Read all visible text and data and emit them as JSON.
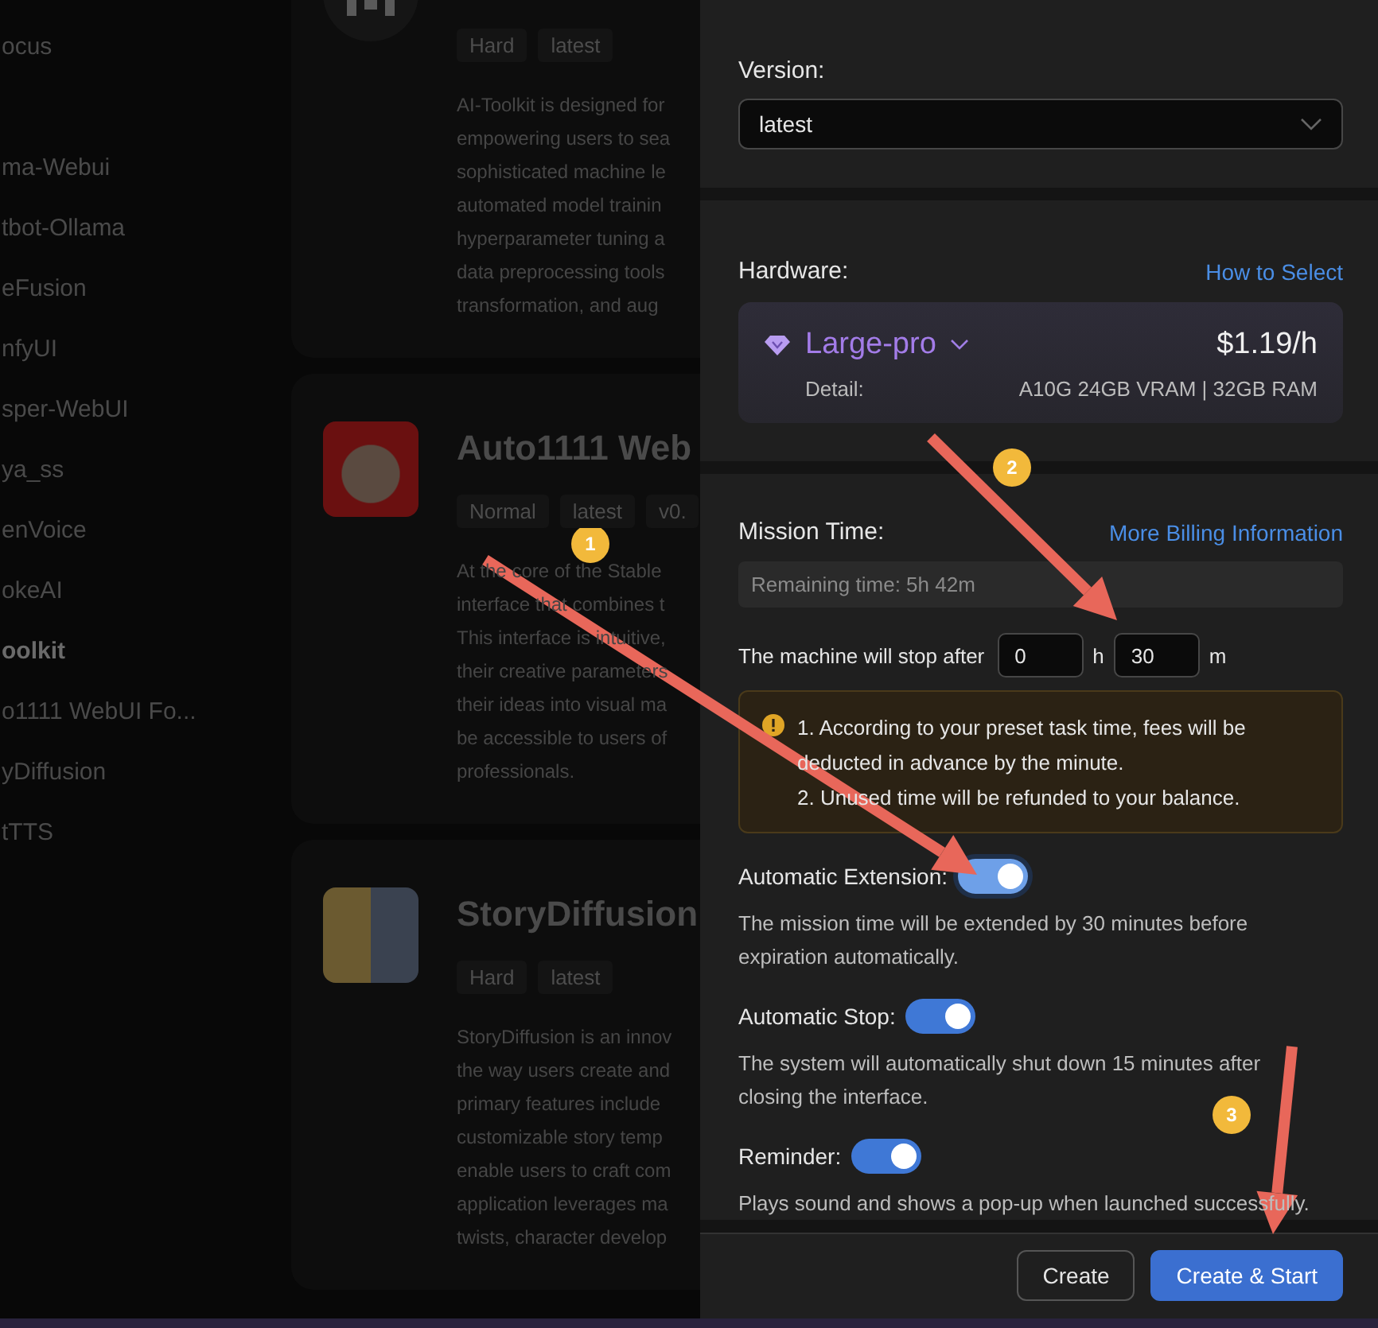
{
  "sidebar": {
    "items": [
      {
        "label": "ocus",
        "selected": false
      },
      {
        "label": "ma-Webui",
        "selected": false
      },
      {
        "label": "tbot-Ollama",
        "selected": false
      },
      {
        "label": "eFusion",
        "selected": false
      },
      {
        "label": "nfyUI",
        "selected": false
      },
      {
        "label": "sper-WebUI",
        "selected": false
      },
      {
        "label": "ya_ss",
        "selected": false
      },
      {
        "label": "enVoice",
        "selected": false
      },
      {
        "label": "okeAI",
        "selected": false
      },
      {
        "label": "oolkit",
        "selected": true
      },
      {
        "label": "o1111 WebUI Fo...",
        "selected": false
      },
      {
        "label": "yDiffusion",
        "selected": false
      },
      {
        "label": "tTTS",
        "selected": false
      }
    ]
  },
  "apps": [
    {
      "kind": "logo",
      "tags": [
        "Hard",
        "latest"
      ],
      "description": [
        "AI-Toolkit is designed for",
        "empowering users to sea",
        "sophisticated machine le",
        "automated model trainin",
        "hyperparameter tuning a",
        "data preprocessing tools",
        "transformation, and aug"
      ]
    },
    {
      "kind": "cat",
      "title": "Auto1111 Web",
      "tags": [
        "Normal",
        "latest",
        "v0."
      ],
      "description": [
        "At the core of the Stable",
        "interface that combines t",
        "This interface is intuitive,",
        "their creative parameters",
        "their ideas into visual ma",
        "be accessible to users of",
        "professionals."
      ]
    },
    {
      "kind": "comic",
      "title": "StoryDiffusion",
      "tags": [
        "Hard",
        "latest"
      ],
      "description": [
        "StoryDiffusion is an innov",
        "the way users create and",
        "primary features include",
        "customizable story temp",
        "enable users to craft com",
        "application leverages ma",
        "twists, character develop"
      ]
    }
  ],
  "panel": {
    "version": {
      "label": "Version:",
      "value": "latest"
    },
    "hardware": {
      "label": "Hardware:",
      "link": "How to Select",
      "name": "Large-pro",
      "price": "$1.19/h",
      "detail_label": "Detail:",
      "detail": "A10G 24GB VRAM | 32GB RAM"
    },
    "mission": {
      "label": "Mission Time:",
      "link": "More Billing Information",
      "remaining": "Remaining time: 5h 42m",
      "stop_label": "The machine will stop after",
      "hours": "0",
      "hours_unit": "h",
      "minutes": "30",
      "minutes_unit": "m",
      "notice": [
        "1. According to your preset task time, fees will be deducted in advance by the minute.",
        "2. Unused time will be refunded to your balance."
      ]
    },
    "toggles": [
      {
        "label": "Automatic Extension:",
        "on": true,
        "focused": true,
        "description": "The mission time will be extended by 30 minutes before expiration automatically."
      },
      {
        "label": "Automatic Stop:",
        "on": true,
        "focused": false,
        "description": "The system will automatically shut down 15 minutes after closing the interface."
      },
      {
        "label": "Reminder:",
        "on": true,
        "focused": false,
        "description": "Plays sound and shows a pop-up when launched successfully."
      }
    ],
    "buttons": [
      {
        "label": "Create",
        "kind": "secondary"
      },
      {
        "label": "Create & Start",
        "kind": "primary"
      }
    ]
  },
  "annotations": [
    {
      "number": "1"
    },
    {
      "number": "2"
    },
    {
      "number": "3"
    }
  ]
}
